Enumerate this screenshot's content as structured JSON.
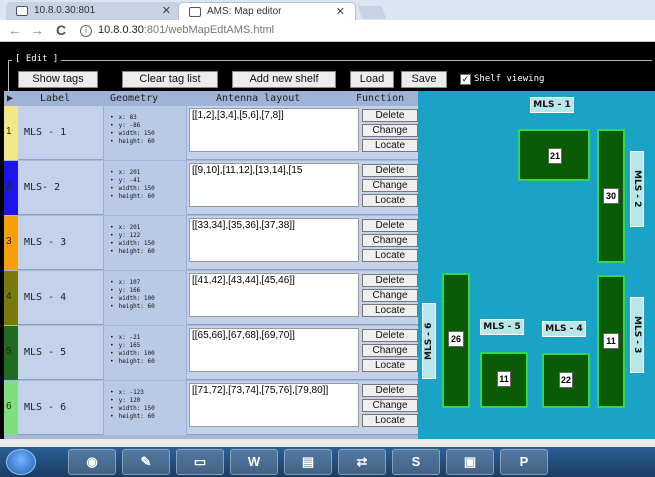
{
  "browser": {
    "tabs": [
      {
        "label": "10.8.0.30:801"
      },
      {
        "label": "AMS: Map editor"
      }
    ],
    "url_host": "10.8.0.30",
    "url_path": ":801/webMapEdtAMS.html"
  },
  "editor": {
    "legend": "[ Edit ]",
    "buttons": {
      "show_tags": "Show tags",
      "clear_tag_list": "Clear tag list",
      "add_new_shelf": "Add new shelf",
      "load": "Load",
      "save": "Save"
    },
    "shelf_viewing": {
      "label": "Shelf viewing",
      "checked": true
    }
  },
  "table": {
    "headers": {
      "label": "Label",
      "geometry": "Geometry",
      "antenna": "Antenna layout",
      "function": "Function"
    },
    "action_labels": {
      "delete": "Delete",
      "change": "Change",
      "locate": "Locate"
    },
    "rows": [
      {
        "num": "1",
        "label": "MLS - 1",
        "color": "#f2e88a",
        "geo": [
          "x: 83",
          "y: -86",
          "width: 150",
          "height: 60"
        ],
        "antenna": "[[1,2],[3,4],[5,6],[7,8]]"
      },
      {
        "num": "2",
        "label": "MLS- 2",
        "color": "#1d14e8",
        "geo": [
          "x: 201",
          "y: -41",
          "width: 150",
          "height: 60"
        ],
        "antenna": "[[9,10],[11,12],[13,14],[15"
      },
      {
        "num": "3",
        "label": "MLS - 3",
        "color": "#f5a00a",
        "geo": [
          "x: 201",
          "y: 122",
          "width: 150",
          "height: 60"
        ],
        "antenna": "[[33,34],[35,36],[37,38]]"
      },
      {
        "num": "4",
        "label": "MLS - 4",
        "color": "#7a7a0c",
        "geo": [
          "x: 107",
          "y: 166",
          "width: 100",
          "height: 60"
        ],
        "antenna": "[[41,42],[43,44],[45,46]]"
      },
      {
        "num": "5",
        "label": "MLS - 5",
        "color": "#1f6b1f",
        "geo": [
          "x: -21",
          "y: 165",
          "width: 100",
          "height: 60"
        ],
        "antenna": "[[65,66],[67,68],[69,70]]"
      },
      {
        "num": "6",
        "label": "MLS - 6",
        "color": "#7de07d",
        "geo": [
          "x: -123",
          "y: 120",
          "width: 150",
          "height: 60"
        ],
        "antenna": "[[71,72],[73,74],[75,76],[79,80]]"
      }
    ]
  },
  "map": {
    "labels": {
      "mls1": "MLS - 1",
      "mls2": "MLS - 2",
      "mls3": "MLS - 3",
      "mls4": "MLS - 4",
      "mls5": "MLS - 5",
      "mls6": "MLS - 6"
    },
    "tags": {
      "t21": "21",
      "t30": "30",
      "t26": "26",
      "t11a": "11",
      "t11b": "11",
      "t22": "22"
    }
  },
  "colors": {
    "map_bg": "#1aa3c6",
    "shelf_fill": "#0a5a06",
    "shelf_border": "#32d650"
  },
  "taskbar_icons": [
    "windows-start-icon",
    "chrome-icon",
    "paint-icon",
    "folder-icon",
    "word-icon",
    "notepad-icon",
    "teamviewer-icon",
    "skype-icon",
    "remote-desktop-icon",
    "powerpoint-icon"
  ]
}
